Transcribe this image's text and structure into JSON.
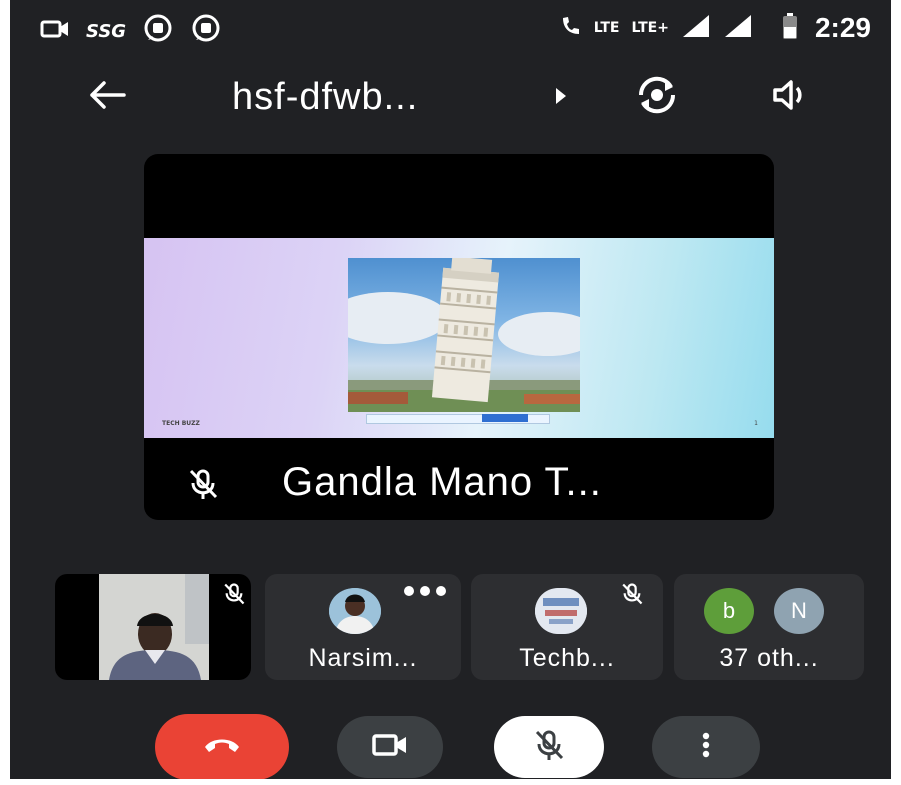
{
  "status_bar": {
    "app_label": "SSG",
    "network_1": "LTE",
    "network_2": "LTE+",
    "time": "2:29",
    "icons": [
      "video-camera-icon",
      "chat-bubble-icon",
      "chat-bubble-icon",
      "call-lte-icon",
      "signal-icon",
      "signal-icon",
      "battery-icon"
    ]
  },
  "top_bar": {
    "meeting_code": "hsf-dfwb...",
    "icons": [
      "back-arrow-icon",
      "dropdown-caret-icon",
      "switch-camera-icon",
      "speaker-icon"
    ]
  },
  "main_tile": {
    "name": "Gandla Mano T...",
    "muted": true,
    "slide": {
      "brand": "TECH BUZZ",
      "page_number": "1"
    }
  },
  "participants": [
    {
      "kind": "self",
      "muted": true
    },
    {
      "name": "Narsim...",
      "muted": false,
      "has_more_menu": true
    },
    {
      "name": "Techb...",
      "muted": true
    },
    {
      "name": "37 oth...",
      "avatars": [
        {
          "initial": "b",
          "color": "#5e9e3a"
        },
        {
          "initial": "N",
          "color": "#8fa3b1"
        }
      ]
    }
  ],
  "controls": [
    {
      "name": "end-call",
      "icon": "hang-up-icon",
      "color": "#ea4335"
    },
    {
      "name": "camera",
      "icon": "video-camera-icon",
      "color": "#3c4043"
    },
    {
      "name": "microphone",
      "icon": "mic-off-icon",
      "color": "#ffffff"
    },
    {
      "name": "more-options",
      "icon": "more-vert-icon",
      "color": "#3c4043"
    }
  ]
}
